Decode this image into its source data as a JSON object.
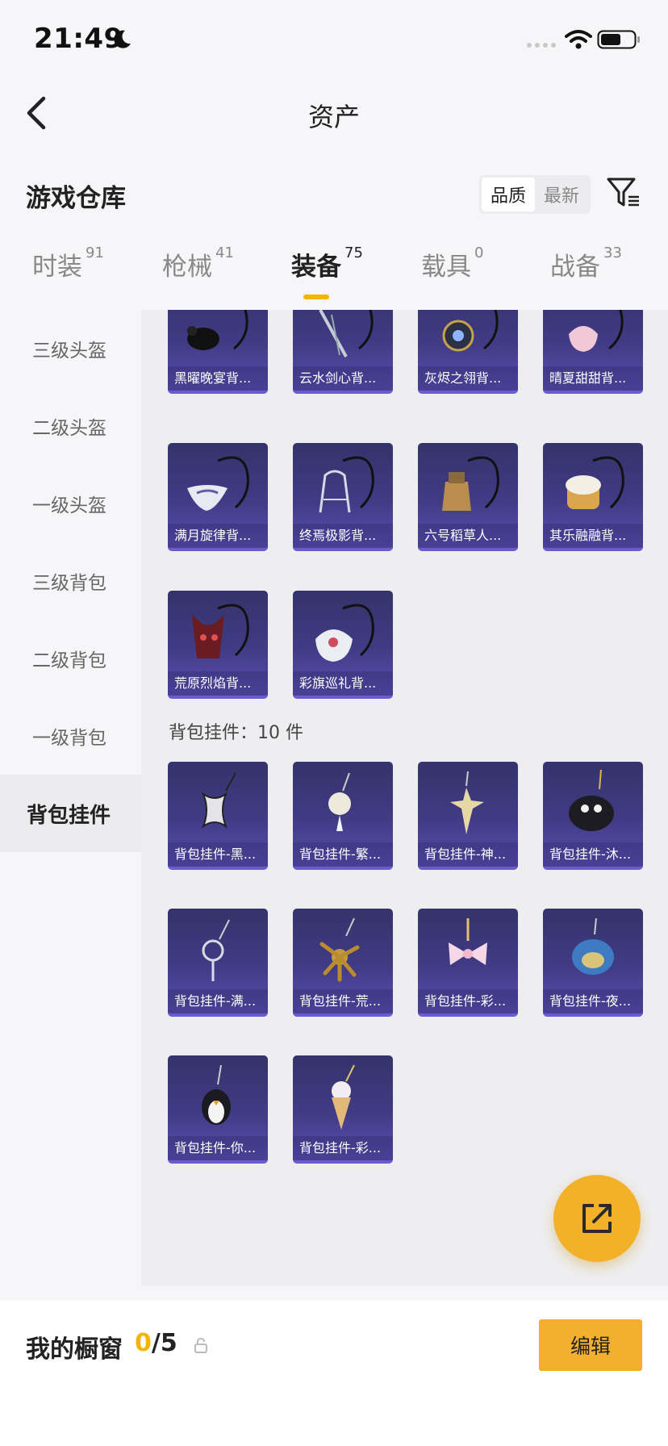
{
  "status_bar": {
    "time": "21:49"
  },
  "nav": {
    "title": "资产"
  },
  "header": {
    "title": "游戏仓库",
    "sort_options": [
      "品质",
      "最新"
    ]
  },
  "tabs": [
    {
      "label": "时装",
      "count": "91"
    },
    {
      "label": "枪械",
      "count": "41"
    },
    {
      "label": "装备",
      "count": "75"
    },
    {
      "label": "载具",
      "count": "0"
    },
    {
      "label": "战备",
      "count": "33"
    }
  ],
  "sidebar": {
    "items": [
      {
        "label": "三级头盔"
      },
      {
        "label": "二级头盔"
      },
      {
        "label": "一级头盔"
      },
      {
        "label": "三级背包"
      },
      {
        "label": "二级背包"
      },
      {
        "label": "一级背包"
      },
      {
        "label": "背包挂件"
      }
    ],
    "active_index": 6
  },
  "backpacks": {
    "items": [
      {
        "name": "黑曜晚宴背..."
      },
      {
        "name": "云水剑心背..."
      },
      {
        "name": "灰烬之翎背..."
      },
      {
        "name": "晴夏甜甜背..."
      },
      {
        "name": "满月旋律背..."
      },
      {
        "name": "终焉极影背..."
      },
      {
        "name": "六号稻草人..."
      },
      {
        "name": "其乐融融背..."
      },
      {
        "name": "荒原烈焰背..."
      },
      {
        "name": "彩旗巡礼背..."
      }
    ]
  },
  "pendants": {
    "heading": "背包挂件：10 件",
    "items": [
      {
        "name": "背包挂件-黑..."
      },
      {
        "name": "背包挂件-繁..."
      },
      {
        "name": "背包挂件-神..."
      },
      {
        "name": "背包挂件-沐..."
      },
      {
        "name": "背包挂件-满..."
      },
      {
        "name": "背包挂件-荒..."
      },
      {
        "name": "背包挂件-彩..."
      },
      {
        "name": "背包挂件-夜..."
      },
      {
        "name": "背包挂件-你..."
      },
      {
        "name": "背包挂件-彩..."
      }
    ]
  },
  "showcase": {
    "label": "我的橱窗",
    "current": "0",
    "total": "/5",
    "edit_label": "编辑"
  },
  "colors": {
    "accent": "#f5b400",
    "card_top": "#34336a",
    "card_bottom": "#5b4fb0"
  }
}
